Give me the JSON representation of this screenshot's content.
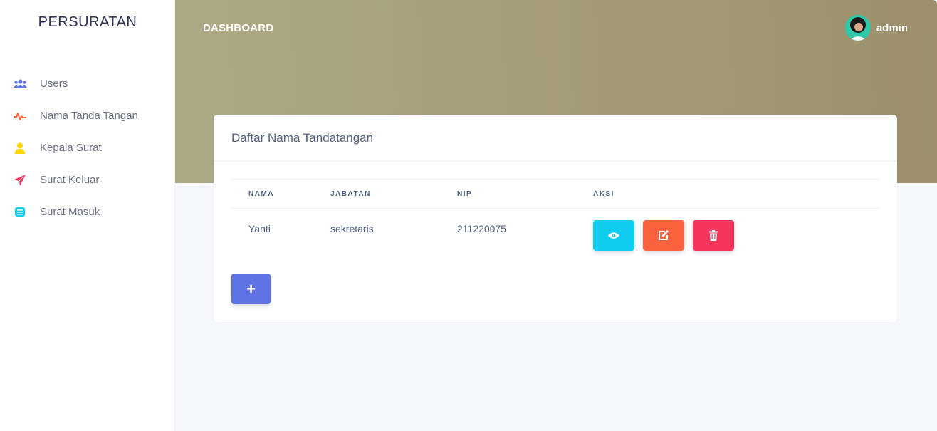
{
  "brand": "PERSURATAN",
  "sidebar": {
    "items": [
      {
        "label": "Users",
        "icon": "users-icon",
        "color": "#5e72e4"
      },
      {
        "label": "Nama Tanda Tangan",
        "icon": "pulse-icon",
        "color": "#fb6340"
      },
      {
        "label": "Kepala Surat",
        "icon": "single-user-icon",
        "color": "#ffd600"
      },
      {
        "label": "Surat Keluar",
        "icon": "send-icon",
        "color": "#f5365c"
      },
      {
        "label": "Surat Masuk",
        "icon": "inbox-icon",
        "color": "#11cdef"
      }
    ]
  },
  "header": {
    "title": "DASHBOARD",
    "user": "admin"
  },
  "card": {
    "title": "Daftar Nama Tandatangan",
    "columns": [
      "NAMA",
      "JABATAN",
      "NIP",
      "AKSI"
    ],
    "rows": [
      {
        "nama": "Yanti",
        "jabatan": "sekretaris",
        "nip": "211220075"
      }
    ],
    "actions": {
      "view_color": "#11cdef",
      "edit_color": "#fb6340",
      "delete_color": "#f5365c"
    },
    "add_label": "+"
  }
}
